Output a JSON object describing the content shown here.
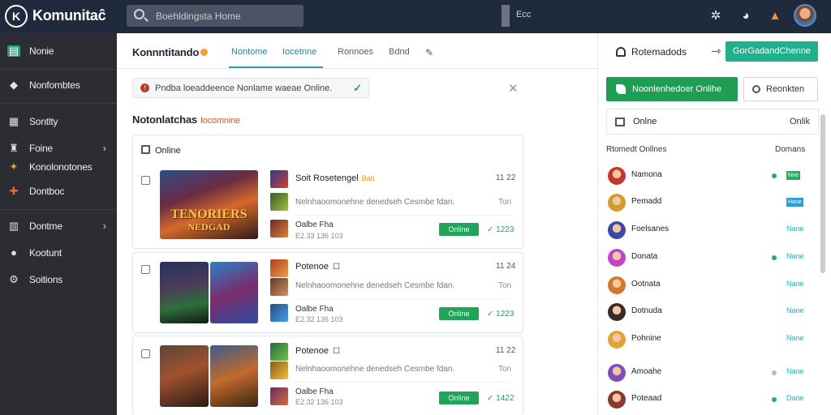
{
  "app": {
    "title": "Komunitaĉ",
    "logo_glyph": "K"
  },
  "search": {
    "placeholder": "Boehldingsta Home"
  },
  "topbar": {
    "mid_text": "Ecc",
    "icons": [
      "bug-icon",
      "chat-bubble-icon",
      "notification-bell-icon"
    ]
  },
  "sidebar": {
    "items": [
      {
        "label": "Nonie",
        "icon": "home-icon"
      },
      {
        "label": "Nonfombtes",
        "icon": "diamond-icon"
      },
      {
        "label": "Sontlty",
        "icon": "grid-icon"
      },
      {
        "label": "Foine",
        "icon": "game-icon"
      },
      {
        "label": "Konolonotones",
        "icon": "party-icon"
      },
      {
        "label": "Dontboc",
        "icon": "puzzle-icon"
      },
      {
        "label": "Dontme",
        "icon": "calendar-icon"
      },
      {
        "label": "Kootunt",
        "icon": "user-icon"
      },
      {
        "label": "Soitions",
        "icon": "settings-icon"
      }
    ]
  },
  "header": {
    "title": "Konnntitando",
    "tabs": [
      "Nontome",
      "Iocetnne",
      "Ronnoes",
      "Bdnd"
    ]
  },
  "alert": {
    "text": "Pndba loeaddeence Nonlame waeae Online."
  },
  "section": {
    "title": "Notonlatchas",
    "subtitle": "Iocomnine"
  },
  "cards": [
    {
      "header": "Online",
      "thumb_lines": [
        "TENORIERS",
        "NEDGAD"
      ],
      "rows": [
        {
          "title": "Soit Rosetengel",
          "tag": "Bab",
          "time": "11 22",
          "desc": "Nelnhaoomonehne denedseh Cesmbe fdan.",
          "right": "Ton",
          "meta": "Oalbe Fha",
          "sub": "E2.33 136 103",
          "button": "Online",
          "num": "1223"
        }
      ]
    },
    {
      "rows": [
        {
          "title": "Potenoe",
          "time": "11 24",
          "desc": "Nelnhaoomonehne denedseh Cesmbe fdan.",
          "right": "Ton",
          "meta": "Oalbe Fha",
          "sub": "E2.32 136 103",
          "button": "Online",
          "num": "1223"
        }
      ]
    },
    {
      "rows": [
        {
          "title": "Potenoe",
          "time": "11 22",
          "desc": "Nelnhaoomonehne denedseh Cesmbe fdan.",
          "right": "Ton",
          "meta": "Oalbe Fha",
          "sub": "E2.32 136 103",
          "button": "Online",
          "num": "1422"
        }
      ]
    }
  ],
  "right": {
    "header": "Rotemadods",
    "header_button": "GorGadandChenne",
    "online_button": "Noonlenhedoer Onlihe",
    "search_button": "Reonkten",
    "filter_label": "Onlne",
    "filter_right": "Onlik",
    "list_head": "Rtomedt Onllnes",
    "list_head_right": "Domans",
    "users": [
      {
        "name": "Namona",
        "status": "Nne",
        "status_type": "tag-green",
        "dot": "#27ae60",
        "avatar": "#c0392b"
      },
      {
        "name": "Pemadd",
        "status": "Hane",
        "status_type": "tag-blue",
        "dot": "",
        "avatar": "#d39b2a"
      },
      {
        "name": "Foelsanes",
        "status": "Nane",
        "status_type": "text",
        "dot": "",
        "avatar": "#3949ab"
      },
      {
        "name": "Donata",
        "status": "Nane",
        "status_type": "text",
        "dot": "#27ae60",
        "avatar": "#c145c8"
      },
      {
        "name": "Ootnata",
        "status": "Nane",
        "status_type": "text",
        "dot": "",
        "avatar": "#d4772b"
      },
      {
        "name": "Dotnuda",
        "status": "Nane",
        "status_type": "text",
        "dot": "",
        "avatar": "#3a2a25"
      },
      {
        "name": "Pohnine",
        "status": "Nane",
        "status_type": "text",
        "dot": "",
        "avatar": "#e0a33a"
      },
      {
        "name": "Amoahe",
        "status": "Nane",
        "status_type": "text",
        "dot": "#bbbbbb",
        "avatar": "#7d4fb8"
      },
      {
        "name": "Poteaad",
        "status": "Dane",
        "status_type": "text",
        "dot": "#27ae60",
        "avatar": "#8a3a2a"
      }
    ]
  }
}
